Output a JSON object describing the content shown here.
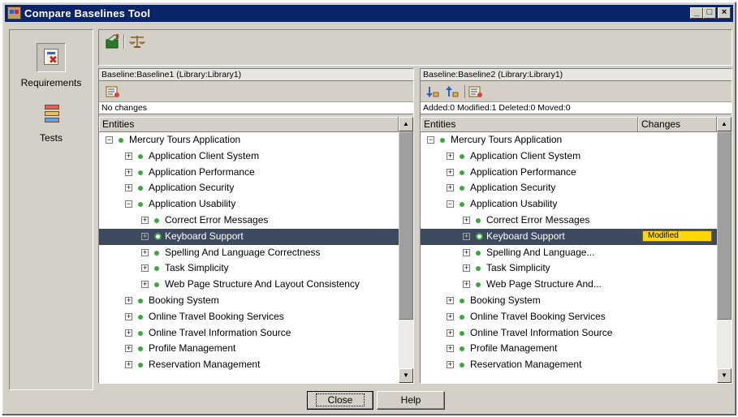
{
  "window": {
    "title": "Compare Baselines Tool"
  },
  "rail": {
    "items": [
      {
        "label": "Requirements",
        "icon": "requirements-icon",
        "selected": true
      },
      {
        "label": "Tests",
        "icon": "tests-icon",
        "selected": false
      }
    ]
  },
  "left": {
    "header": "Baseline:Baseline1 (Library:Library1)",
    "summary": "No changes",
    "columns": [
      "Entities"
    ],
    "rows": [
      {
        "label": "Mercury Tours Application",
        "level": 0,
        "expander": "−"
      },
      {
        "label": "Application Client System",
        "level": 1,
        "expander": "+"
      },
      {
        "label": "Application Performance",
        "level": 1,
        "expander": "+"
      },
      {
        "label": "Application Security",
        "level": 1,
        "expander": "+"
      },
      {
        "label": "Application Usability",
        "level": 1,
        "expander": "−"
      },
      {
        "label": "Correct Error Messages",
        "level": 2,
        "expander": "+"
      },
      {
        "label": "Keyboard Support",
        "level": 2,
        "expander": "+",
        "selected": true
      },
      {
        "label": "Spelling And Language Correctness",
        "level": 2,
        "expander": "+"
      },
      {
        "label": "Task Simplicity",
        "level": 2,
        "expander": "+"
      },
      {
        "label": "Web Page Structure And Layout Consistency",
        "level": 2,
        "expander": "+"
      },
      {
        "label": "Booking System",
        "level": 1,
        "expander": "+"
      },
      {
        "label": "Online Travel Booking Services",
        "level": 1,
        "expander": "+"
      },
      {
        "label": "Online Travel Information Source",
        "level": 1,
        "expander": "+"
      },
      {
        "label": "Profile Management",
        "level": 1,
        "expander": "+"
      },
      {
        "label": "Reservation Management",
        "level": 1,
        "expander": "+"
      }
    ]
  },
  "right": {
    "header": "Baseline:Baseline2 (Library:Library1)",
    "summary": "Added:0  Modified:1  Deleted:0  Moved:0",
    "columns": [
      "Entities",
      "Changes"
    ],
    "rows": [
      {
        "label": "Mercury Tours Application",
        "level": 0,
        "expander": "−"
      },
      {
        "label": "Application Client System",
        "level": 1,
        "expander": "+"
      },
      {
        "label": "Application Performance",
        "level": 1,
        "expander": "+"
      },
      {
        "label": "Application Security",
        "level": 1,
        "expander": "+"
      },
      {
        "label": "Application Usability",
        "level": 1,
        "expander": "−"
      },
      {
        "label": "Correct Error Messages",
        "level": 2,
        "expander": "+"
      },
      {
        "label": "Keyboard Support",
        "level": 2,
        "expander": "+",
        "selected": true,
        "change": "Modified"
      },
      {
        "label": "Spelling  And  Language...",
        "level": 2,
        "expander": "+"
      },
      {
        "label": "Task Simplicity",
        "level": 2,
        "expander": "+"
      },
      {
        "label": "Web  Page  Structure  And...",
        "level": 2,
        "expander": "+"
      },
      {
        "label": "Booking System",
        "level": 1,
        "expander": "+"
      },
      {
        "label": "Online Travel Booking Services",
        "level": 1,
        "expander": "+"
      },
      {
        "label": "Online Travel Information Source",
        "level": 1,
        "expander": "+"
      },
      {
        "label": "Profile Management",
        "level": 1,
        "expander": "+"
      },
      {
        "label": "Reservation Management",
        "level": 1,
        "expander": "+"
      }
    ]
  },
  "buttons": {
    "close": "Close",
    "help": "Help"
  },
  "colors": {
    "title_bar": "#0a246a",
    "selected_row": "#3e4a5e",
    "modified_badge": "#ffd800",
    "node_dot": "#3aa83a"
  }
}
